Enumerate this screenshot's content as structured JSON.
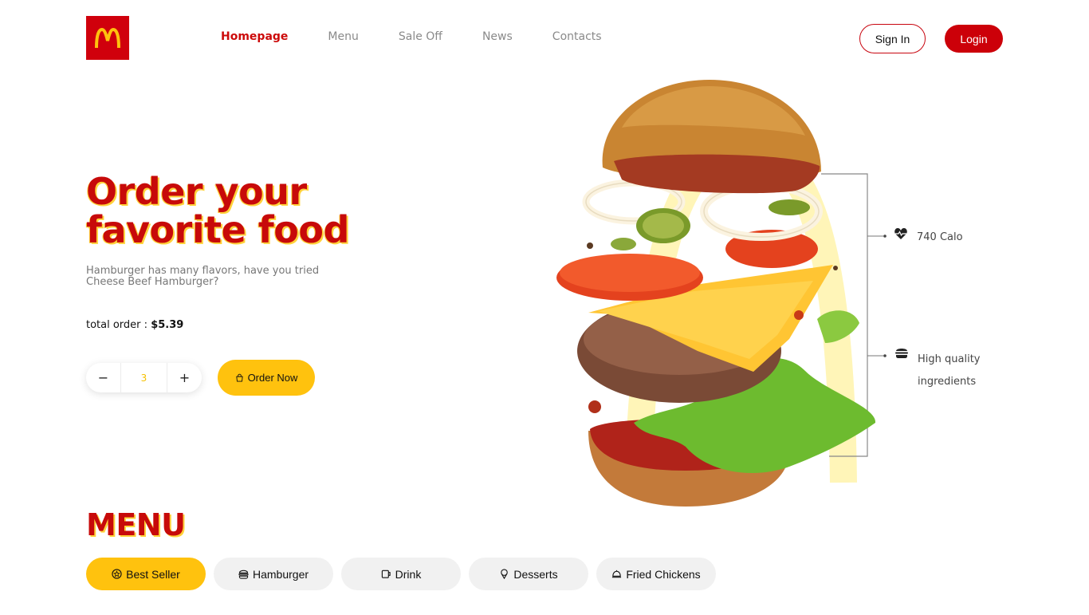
{
  "brand": {
    "color": "#d0000c",
    "accent": "#ffc20e",
    "logo_icon": "golden-arches-logo-icon"
  },
  "nav": {
    "items": [
      {
        "label": "Homepage",
        "active": true
      },
      {
        "label": "Menu",
        "active": false
      },
      {
        "label": "Sale Off",
        "active": false
      },
      {
        "label": "News",
        "active": false
      },
      {
        "label": "Contacts",
        "active": false
      }
    ],
    "signin_label": "Sign In",
    "login_label": "Login"
  },
  "hero": {
    "title_line1": "Order your",
    "title_line2": "favorite food",
    "description": "Hamburger has many flavors, have you tried Cheese Beef Hamburger?",
    "total_label": "total order :",
    "total_value": "$5.39",
    "quantity": "3",
    "minus_label": "−",
    "plus_label": "+",
    "order_label": "Order Now"
  },
  "features": [
    {
      "icon": "heart-pulse-icon",
      "label": "740 Calo"
    },
    {
      "icon": "burger-icon",
      "label_line1": "High quality",
      "label_line2": "ingredients"
    }
  ],
  "menu": {
    "title": "MENU",
    "tabs": [
      {
        "icon": "star-badge-icon",
        "label": "Best Seller",
        "active": true
      },
      {
        "icon": "burger-icon",
        "label": "Hamburger",
        "active": false
      },
      {
        "icon": "cup-icon",
        "label": "Drink",
        "active": false
      },
      {
        "icon": "ice-cream-icon",
        "label": "Desserts",
        "active": false
      },
      {
        "icon": "cloche-icon",
        "label": "Fried Chickens",
        "active": false
      }
    ]
  }
}
